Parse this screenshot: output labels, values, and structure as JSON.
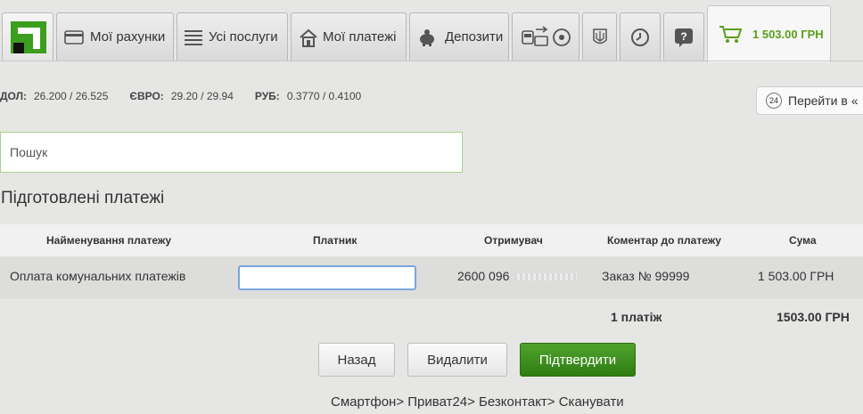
{
  "nav": {
    "accounts_label": "Мої рахунки",
    "services_label": "Усі послуги",
    "payments_label": "Мої платежі",
    "deposits_label": "Депозити",
    "cart_amount": "1 503.00 ГРН",
    "icons": [
      "privat-logo-icon",
      "card-icon",
      "list-icon",
      "house-icon",
      "piggy-bank-icon",
      "travel-icon",
      "football-icon",
      "coat-of-arms-icon",
      "clock-icon",
      "help-icon",
      "cart-icon"
    ],
    "colors": {
      "accent": "#5a9e1a",
      "logo_green": "#3c9e1e"
    }
  },
  "rates": {
    "usd_label": "ДОЛ:",
    "usd_value": "26.200 / 26.525",
    "eur_label": "ЄВРО:",
    "eur_value": "29.20 / 29.94",
    "rub_label": "РУБ:",
    "rub_value": "0.3770 / 0.4100"
  },
  "goto": {
    "badge": "24",
    "label": "Перейти в «"
  },
  "search": {
    "placeholder": "Пошук",
    "value": ""
  },
  "page_title": "Підготовлені платежі",
  "table": {
    "headers": [
      "Найменування платежу",
      "Платник",
      "Отримувач",
      "Коментар до платежу",
      "Сума"
    ],
    "rows": [
      {
        "name": "Оплата комунальних платежів",
        "payer": "",
        "recipient": "2600 096",
        "comment": "Заказ № 99999",
        "amount": "1 503.00 ГРН"
      }
    ],
    "summary": {
      "count": "1 платіж",
      "total": "1503.00 ГРН"
    }
  },
  "buttons": {
    "back": "Назад",
    "delete": "Видалити",
    "confirm": "Підтвердити",
    "confirm_color": "#3b8f1c"
  },
  "footer": "Смартфон> Приват24> Безконтакт> Сканувати"
}
